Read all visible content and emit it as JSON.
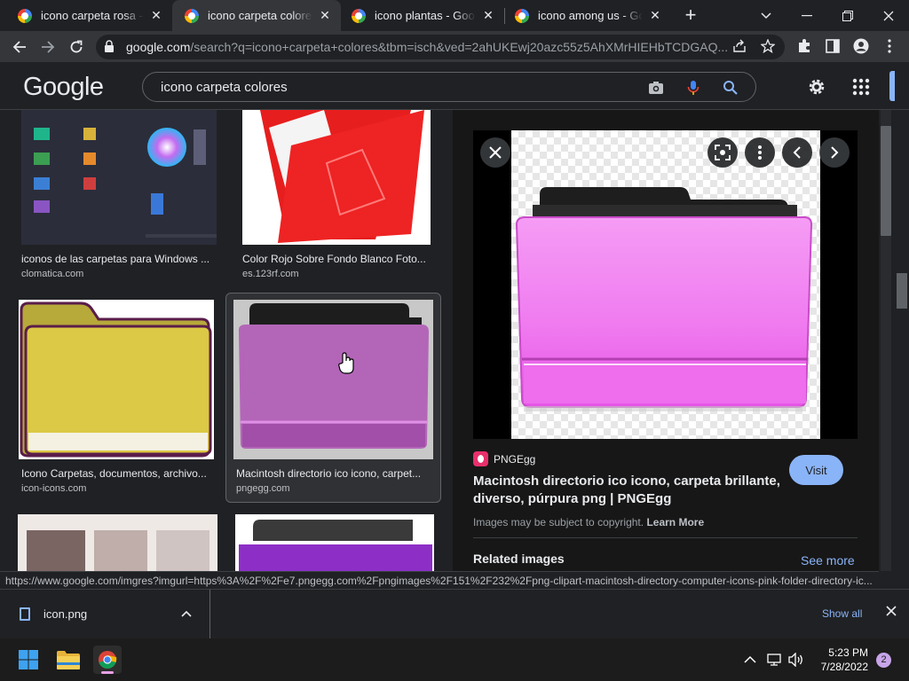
{
  "browser": {
    "tabs": [
      {
        "label": "icono carpeta rosa - Google",
        "active": false
      },
      {
        "label": "icono carpeta colores - Google",
        "active": true
      },
      {
        "label": "icono plantas - Google",
        "active": false
      },
      {
        "label": "icono among us - Google",
        "active": false
      }
    ],
    "new_tab": "+",
    "url_host": "google.com",
    "url_rest": "/search?q=icono+carpeta+colores&tbm=isch&ved=2ahUKEwj20azc55z5AhXMrHIEHbTCDGAQ..."
  },
  "google": {
    "logo": "Google",
    "query": "icono carpeta colores"
  },
  "results": [
    {
      "title": "iconos de las carpetas para Windows ...",
      "source": "clomatica.com"
    },
    {
      "title": "Color Rojo Sobre Fondo Blanco Foto...",
      "source": "es.123rf.com"
    },
    {
      "title": "Icono Carpetas, documentos, archivo...",
      "source": "icon-icons.com"
    },
    {
      "title": "Macintosh directorio ico icono, carpet...",
      "source": "pngegg.com"
    }
  ],
  "preview": {
    "source_name": "PNGEgg",
    "title": "Macintosh directorio ico icono, carpeta brillante, diverso, púrpura png | PNGEgg",
    "visit_label": "Visit",
    "copyright_text": "Images may be subject to copyright.",
    "learn_more": "Learn More",
    "related_title": "Related images",
    "see_more": "See more"
  },
  "status_url": "https://www.google.com/imgres?imgurl=https%3A%2F%2Fe7.pngegg.com%2Fpngimages%2F151%2F232%2Fpng-clipart-macintosh-directory-computer-icons-pink-folder-directory-ic...",
  "downloads": {
    "file_name": "icon.png",
    "show_all": "Show all"
  },
  "taskbar": {
    "time": "5:23 PM",
    "date": "7/28/2022",
    "notifications": "2"
  },
  "colors": {
    "accent": "#8ab4f8",
    "background": "#202124",
    "folder_pink": "#f07cf0",
    "folder_purple": "#b060b8"
  }
}
